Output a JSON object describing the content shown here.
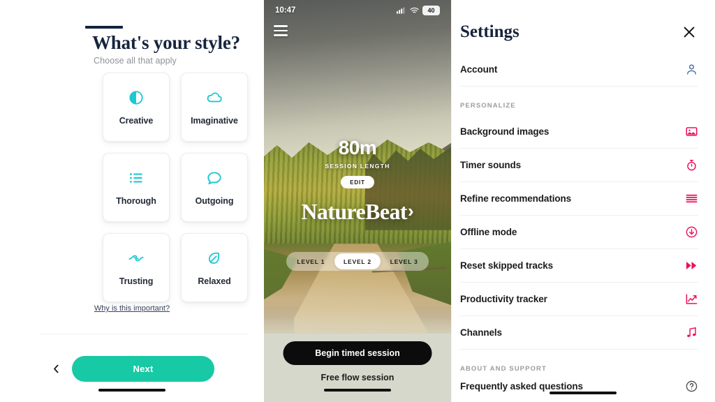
{
  "left_panel": {
    "title": "What's your style?",
    "subtitle": "Choose all that apply",
    "options": [
      {
        "label": "Creative",
        "icon": "contrast-circle-icon"
      },
      {
        "label": "Imaginative",
        "icon": "cloud-icon"
      },
      {
        "label": "Thorough",
        "icon": "list-icon"
      },
      {
        "label": "Outgoing",
        "icon": "speech-bubble-icon"
      },
      {
        "label": "Trusting",
        "icon": "handshake-icon"
      },
      {
        "label": "Relaxed",
        "icon": "leaf-icon"
      }
    ],
    "help_link": "Why is this important?",
    "next_label": "Next",
    "back_icon": "chevron-left-icon",
    "accent_color": "#17c9a4",
    "icon_color": "#1ec8d2",
    "title_color": "#17243d"
  },
  "phone": {
    "status_bar": {
      "time": "10:47",
      "signal_icon": "cellular-signal-icon",
      "wifi_icon": "wifi-icon",
      "battery_level": "40"
    },
    "menu_icon": "hamburger-menu-icon",
    "session_length_value": "80m",
    "session_length_label": "SESSION LENGTH",
    "edit_label": "EDIT",
    "brand": "NatureBeat",
    "brand_chevron": "›",
    "levels": [
      {
        "label": "LEVEL 1",
        "selected": false
      },
      {
        "label": "LEVEL 2",
        "selected": true
      },
      {
        "label": "LEVEL 3",
        "selected": false
      }
    ],
    "primary_button": "Begin timed session",
    "secondary_button": "Free flow session"
  },
  "settings": {
    "title": "Settings",
    "close_icon": "close-icon",
    "account": {
      "label": "Account",
      "icon": "person-icon",
      "icon_color": "#4d72a8"
    },
    "sections": [
      {
        "heading": "PERSONALIZE",
        "items": [
          {
            "label": "Background images",
            "icon": "image-icon"
          },
          {
            "label": "Timer sounds",
            "icon": "stopwatch-icon"
          },
          {
            "label": "Refine recommendations",
            "icon": "sliders-list-icon"
          },
          {
            "label": "Offline mode",
            "icon": "download-circle-icon"
          },
          {
            "label": "Reset skipped tracks",
            "icon": "fast-forward-icon"
          },
          {
            "label": "Productivity tracker",
            "icon": "chart-line-icon"
          },
          {
            "label": "Channels",
            "icon": "music-note-icon"
          }
        ]
      },
      {
        "heading": "ABOUT AND SUPPORT",
        "items": [
          {
            "label": "Frequently asked questions",
            "icon": "help-circle-icon"
          }
        ]
      }
    ],
    "icon_color": "#ed0f59"
  }
}
